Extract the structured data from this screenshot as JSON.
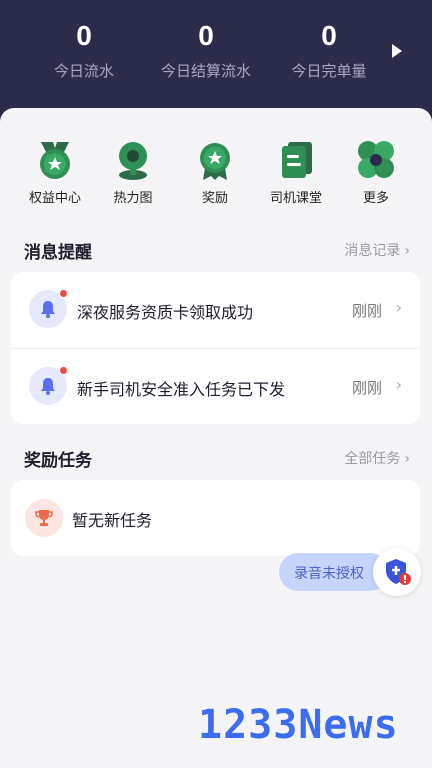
{
  "header": {
    "stats": [
      {
        "value": "0",
        "label": "今日流水"
      },
      {
        "value": "0",
        "label": "今日结算流水"
      },
      {
        "value": "0",
        "label": "今日完单量"
      }
    ],
    "more_icon": "play-arrow-icon"
  },
  "quick_actions": [
    {
      "label": "权益中心",
      "icon": "rights-badge-icon"
    },
    {
      "label": "热力图",
      "icon": "map-pin-icon"
    },
    {
      "label": "奖励",
      "icon": "medal-icon"
    },
    {
      "label": "司机课堂",
      "icon": "course-book-icon"
    },
    {
      "label": "更多",
      "icon": "more-grid-icon"
    }
  ],
  "messages": {
    "title": "消息提醒",
    "link": "消息记录",
    "items": [
      {
        "text": "深夜服务资质卡领取成功",
        "time": "刚刚"
      },
      {
        "text": "新手司机安全准入任务已下发",
        "time": "刚刚"
      }
    ]
  },
  "tasks": {
    "title": "奖励任务",
    "link": "全部任务",
    "empty_text": "暂无新任务"
  },
  "floating": {
    "record_label": "录音未授权"
  },
  "watermark": "1233News",
  "colors": {
    "header_bg": "#2b2b4a",
    "accent_green": "#2f8f57",
    "badge_red": "#e84a4a",
    "pill_blue": "#c7d4fb"
  }
}
